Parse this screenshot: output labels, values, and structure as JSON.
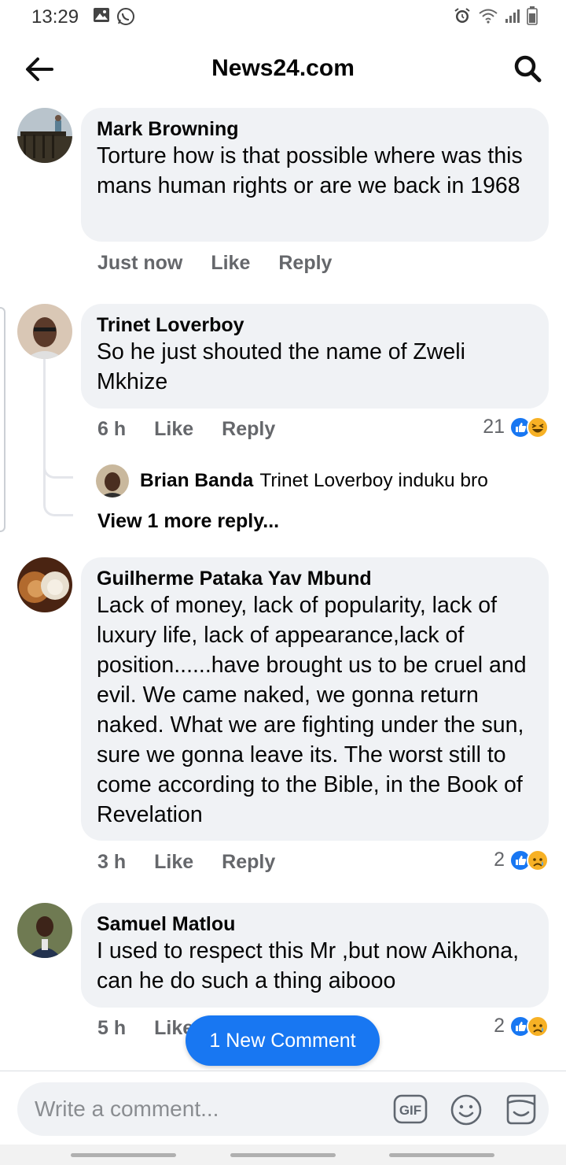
{
  "status_bar": {
    "time": "13:29"
  },
  "app_bar": {
    "title": "News24.com"
  },
  "comments": [
    {
      "author": "Mark Browning",
      "text": "Torture how is that possible where was this mans human rights or are we back in 1968",
      "time": "Just now",
      "like_label": "Like",
      "reply_label": "Reply"
    },
    {
      "author": "Trinet Loverboy",
      "text": "So he just shouted the name of Zweli Mkhize",
      "time": "6 h",
      "like_label": "Like",
      "reply_label": "Reply",
      "reaction_count": "21",
      "reactions": [
        "like-icon",
        "haha-icon"
      ],
      "reply": {
        "author": "Brian Banda",
        "text": "Trinet Loverboy induku bro"
      },
      "view_more": "View 1 more reply..."
    },
    {
      "author": "Guilherme Pataka Yav Mbund",
      "text": "Lack of money, lack of popularity, lack of luxury life, lack of appearance,lack of position......have brought us to be cruel and evil.  We came naked, we gonna return naked.  What we are fighting under the sun, sure we gonna leave its.  The worst still to come according to the Bible, in the Book of Revelation",
      "time": "3 h",
      "like_label": "Like",
      "reply_label": "Reply",
      "reaction_count": "2",
      "reactions": [
        "like-icon",
        "sad-icon"
      ]
    },
    {
      "author": "Samuel Matlou",
      "text": "I used to respect this Mr ,but now Aikhona, can he do such a thing aibooo",
      "time": "5 h",
      "like_label": "Like",
      "reaction_count": "2",
      "reactions": [
        "like-icon",
        "sad-icon"
      ]
    }
  ],
  "new_comment_button": "1 New Comment",
  "composer": {
    "placeholder": "Write a comment...",
    "gif_label": "GIF"
  },
  "colors": {
    "accent": "#1877f2",
    "bubble": "#f0f2f5",
    "secondary_text": "#65676b"
  }
}
